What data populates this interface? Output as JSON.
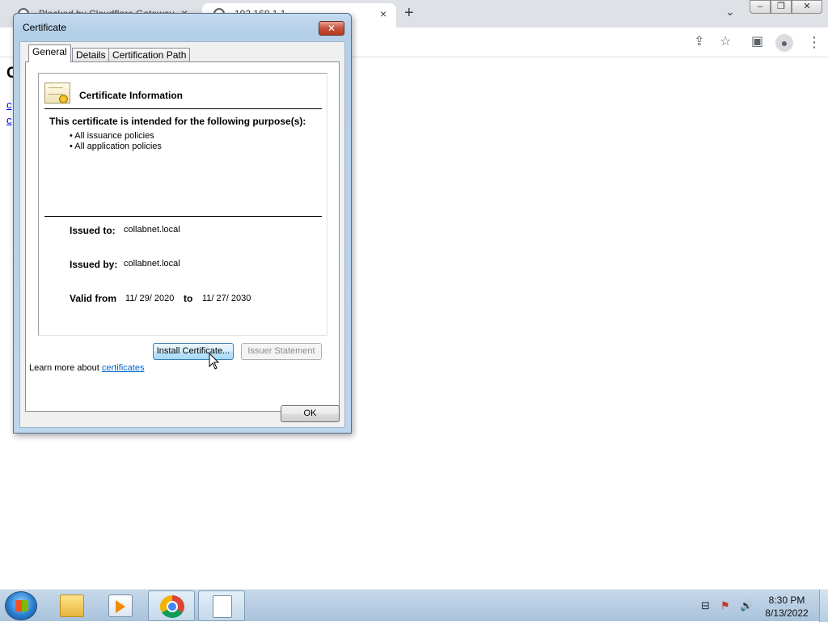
{
  "browser": {
    "tabs": [
      {
        "title": "Blocked by Cloudflare Gateway"
      },
      {
        "title": "192.168.1.1"
      }
    ],
    "tab_close_icon": "×",
    "new_tab_icon": "+",
    "tab_search_icon": "⌄",
    "window_controls": {
      "minimize": "–",
      "maximize": "❐",
      "close": "✕"
    },
    "toolbar_icons": {
      "share": "⇪",
      "star": "☆",
      "sidepanel": "▣",
      "profile": "●",
      "menu": "⋮"
    },
    "page": {
      "heading": "C",
      "links": [
        "c",
        "c"
      ]
    }
  },
  "dialog": {
    "title": "Certificate",
    "close_label": "✕",
    "tabs": [
      "General",
      "Details",
      "Certification Path"
    ],
    "info_title": "Certificate Information",
    "purpose_heading": "This certificate is intended for the following purpose(s):",
    "purposes": [
      "• All issuance policies",
      "• All application policies"
    ],
    "issued_to_label": "Issued to:",
    "issued_to": "collabnet.local",
    "issued_by_label": "Issued by:",
    "issued_by": "collabnet.local",
    "valid_from_label": "Valid from",
    "valid_from": "11/ 29/ 2020",
    "valid_to_label": "to",
    "valid_to": "11/ 27/ 2030",
    "install_button": "Install Certificate...",
    "issuer_button": "Issuer Statement",
    "learn_more_text": "Learn more about ",
    "learn_more_link": "certificates",
    "ok_button": "OK"
  },
  "taskbar": {
    "apps": [
      "explorer",
      "media-player",
      "chrome",
      "notepad"
    ],
    "tray": {
      "network": "⊟",
      "flag": "⚑",
      "volume": "🔊"
    },
    "clock": {
      "time": "8:30 PM",
      "date": "8/13/2022"
    }
  }
}
